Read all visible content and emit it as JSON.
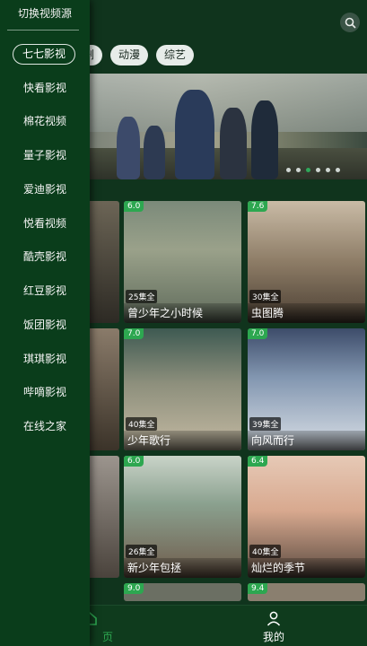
{
  "drawer": {
    "title": "切换视频源",
    "selected": "七七影视",
    "sources": [
      "快看影视",
      "棉花视频",
      "量子影视",
      "爱迪影视",
      "悦看视频",
      "酷壳影视",
      "红豆影视",
      "饭团影视",
      "琪琪影视",
      "哔嘀影视",
      "在线之家"
    ]
  },
  "categories": [
    "电视剧",
    "动漫",
    "综艺"
  ],
  "banner": {
    "slides": 6,
    "active_index": 2
  },
  "cards": [
    {
      "score": "6.0",
      "episodes": "25集全",
      "title": "曾少年之小时候"
    },
    {
      "score": "7.6",
      "episodes": "30集全",
      "title": "虫图腾"
    },
    {
      "score": "7.0",
      "episodes": "40集全",
      "title": "少年歌行"
    },
    {
      "score": "7.0",
      "episodes": "39集全",
      "title": "向风而行"
    },
    {
      "score": "6.0",
      "episodes": "26集全",
      "title": "新少年包拯"
    },
    {
      "score": "6.4",
      "episodes": "40集全",
      "title": "灿烂的季节"
    },
    {
      "score": "9.0",
      "episodes": "",
      "title": ""
    },
    {
      "score": "9.4",
      "episodes": "",
      "title": ""
    }
  ],
  "tabs": {
    "home_label": "页",
    "mine_label": "我的"
  },
  "colors": {
    "accent_green": "#2da750",
    "drawer_bg": "#0a3d1b",
    "tabbar_bg": "#0f3b1d"
  }
}
